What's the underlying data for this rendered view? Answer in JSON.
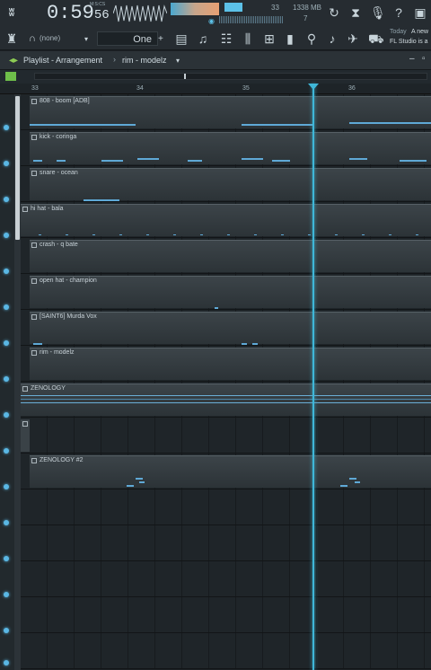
{
  "topbar": {
    "time_main": "0:59",
    "time_sec": "56",
    "time_unit": "M:S:CS",
    "cpu_value": "33",
    "memory": "1338 MB",
    "voices": "7",
    "news_label": "Today",
    "news_text": "A new",
    "news_text2": "FL Studio is a"
  },
  "toolbar2": {
    "pattern_none": "(none)",
    "snap_value": "One"
  },
  "playlist": {
    "title": "Playlist - Arrangement",
    "sep": "›",
    "pattern_name": "rim - modelz"
  },
  "ruler": {
    "bars": [
      "33",
      "34",
      "35",
      "36"
    ]
  },
  "tracks": [
    {
      "clip_label": "808 - boom [ADB]"
    },
    {
      "clip_label": "kick - coringa"
    },
    {
      "clip_label": "snare - ocean"
    },
    {
      "clip_label": "hi hat - bala"
    },
    {
      "clip_label": "crash - q bate"
    },
    {
      "clip_label": "open hat - champion"
    },
    {
      "clip_label": "[SAINT6] Murda Vox"
    },
    {
      "clip_label": "rim - modelz"
    },
    {
      "clip_label": "ZENOLOGY"
    },
    {
      "clip_label": ""
    },
    {
      "clip_label": "ZENOLOGY #2"
    },
    {
      "clip_label": ""
    },
    {
      "clip_label": ""
    },
    {
      "clip_label": ""
    },
    {
      "clip_label": ""
    },
    {
      "clip_label": ""
    }
  ]
}
